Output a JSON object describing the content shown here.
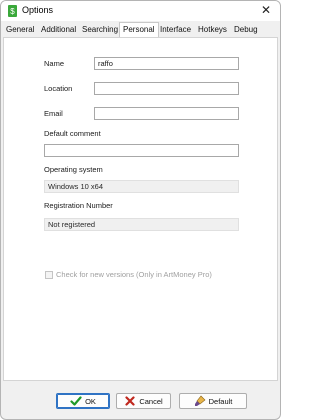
{
  "window": {
    "title": "Options",
    "close_glyph": "✕",
    "app_icon": "artmoney-app-icon"
  },
  "tabs": [
    {
      "label": "General",
      "active": false
    },
    {
      "label": "Additional",
      "active": false
    },
    {
      "label": "Searching",
      "active": false
    },
    {
      "label": "Personal",
      "active": true
    },
    {
      "label": "Interface",
      "active": false
    },
    {
      "label": "Hotkeys",
      "active": false
    },
    {
      "label": "Debug",
      "active": false
    }
  ],
  "personal": {
    "name_label": "Name",
    "name_value": "raffo",
    "location_label": "Location",
    "location_value": "",
    "email_label": "Email",
    "email_value": "",
    "default_comment_label": "Default comment",
    "default_comment_value": "",
    "os_label": "Operating system",
    "os_value": "Windows 10 x64",
    "registration_label": "Registration Number",
    "registration_value": "Not registered",
    "check_updates_label": "Check for new versions (Only in ArtMoney Pro)",
    "check_updates_checked": false,
    "check_updates_enabled": false
  },
  "buttons": {
    "ok_label": "OK",
    "cancel_label": "Cancel",
    "default_label": "Default"
  },
  "colors": {
    "ok_icon": "#1f9a2a",
    "cancel_icon": "#c0281e",
    "focus_border": "#2f73c4"
  }
}
